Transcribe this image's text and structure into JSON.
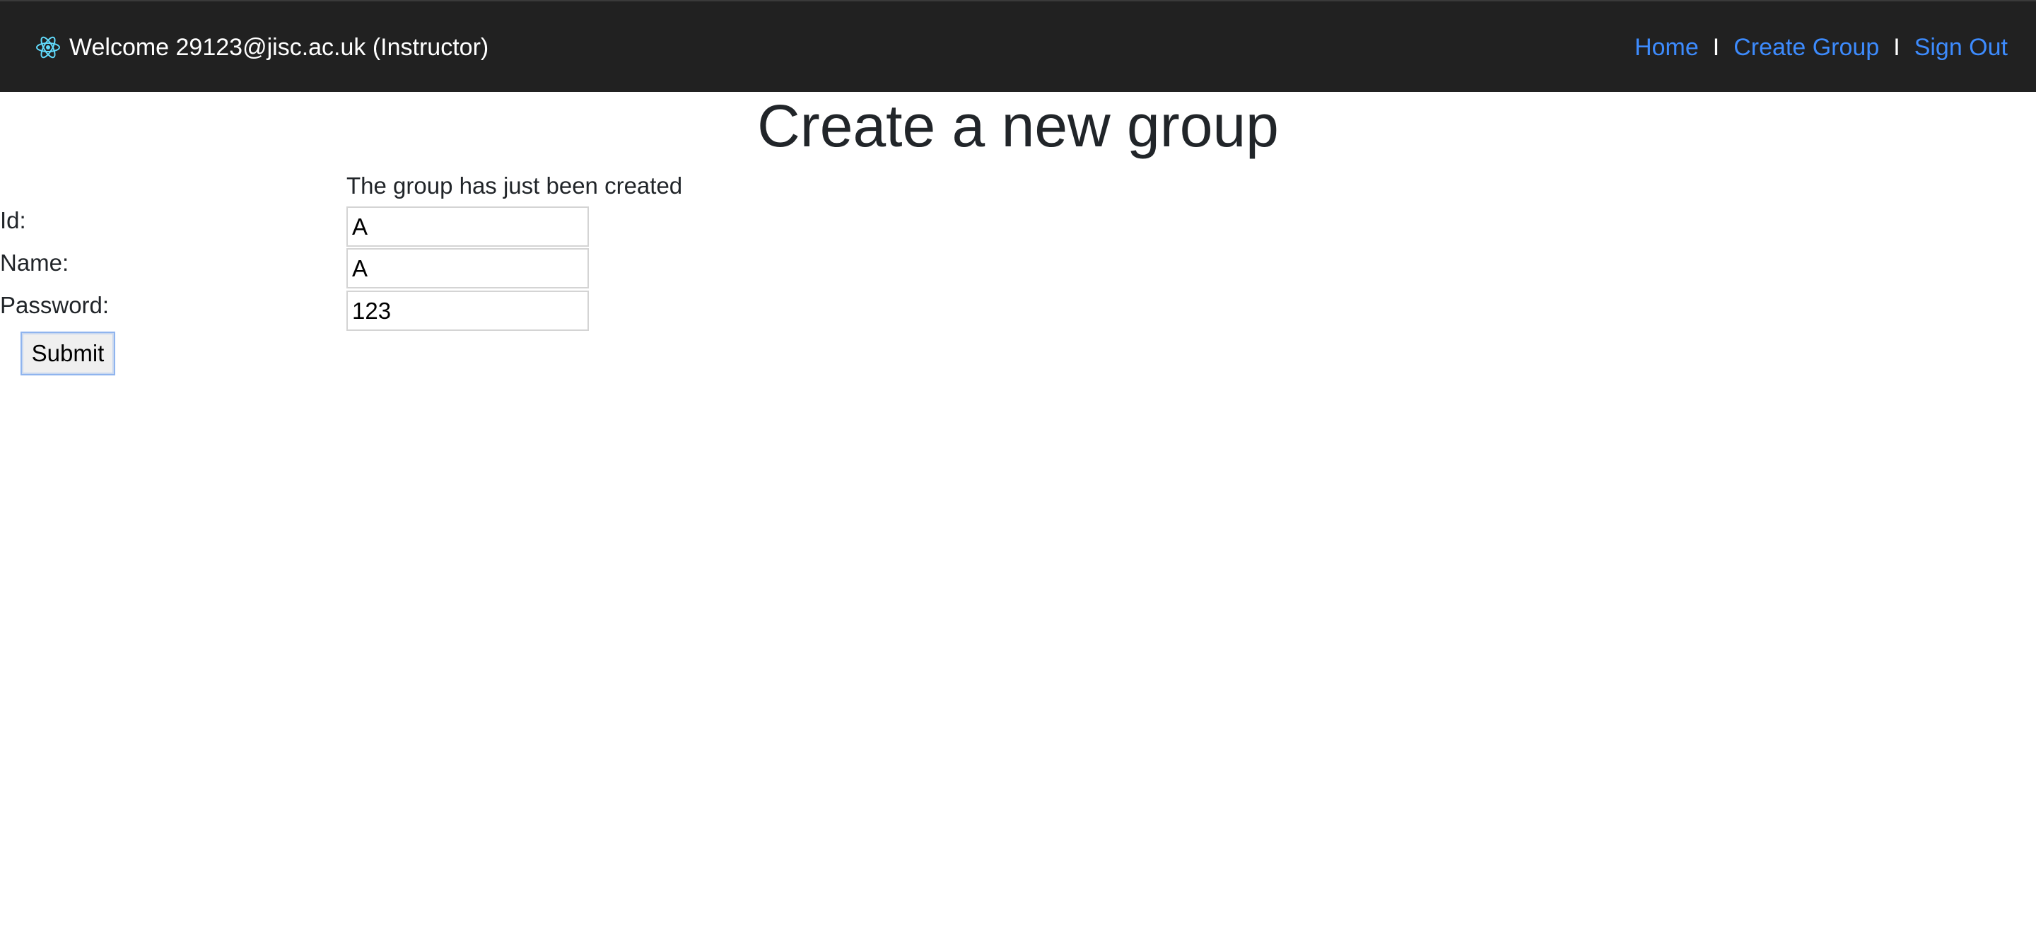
{
  "navbar": {
    "logo_icon": "react-atom-icon",
    "welcome_text": "Welcome 29123@jisc.ac.uk (Instructor)",
    "links": {
      "home": "Home",
      "create_group": "Create Group",
      "sign_out": "Sign Out"
    },
    "separator": "I",
    "link_color": "#3d8bfd",
    "background_color": "#212121"
  },
  "main": {
    "title": "Create a new group",
    "status_message": "The group has just been created",
    "form": {
      "id_label": "Id:",
      "id_value": "A",
      "name_label": "Name:",
      "name_value": "A",
      "password_label": "Password:",
      "password_value": "123",
      "submit_label": "Submit"
    }
  }
}
